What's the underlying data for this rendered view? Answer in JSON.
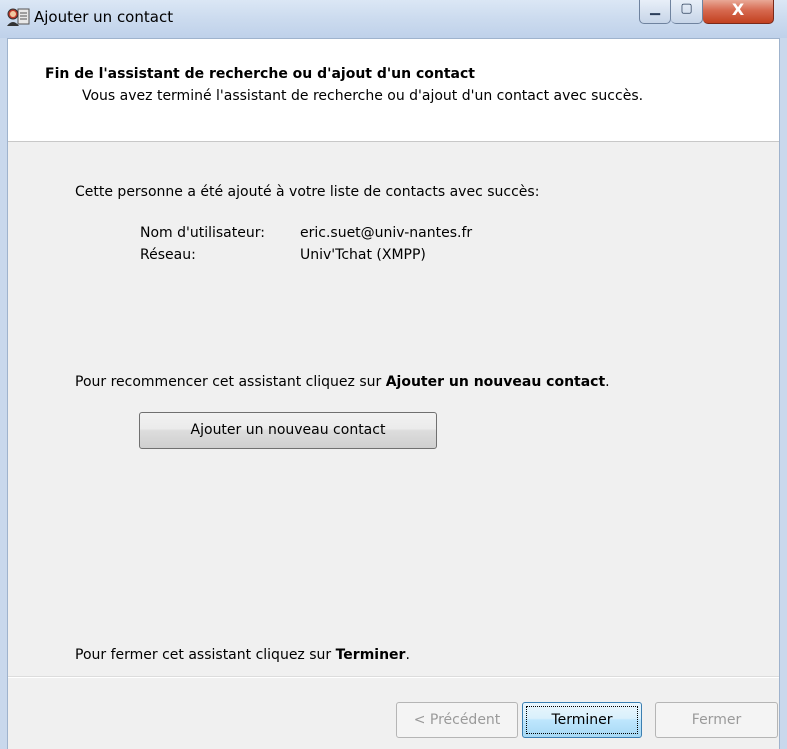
{
  "window": {
    "title": "Ajouter un contact",
    "controls": {
      "minimize": "▁",
      "maximize": "▢",
      "close": "X"
    }
  },
  "header": {
    "title": "Fin de l'assistant de recherche ou d'ajout d'un contact",
    "subtitle": "Vous avez terminé l'assistant de recherche ou d'ajout d'un contact avec succès."
  },
  "body": {
    "success_message": "Cette personne a été ajouté à votre liste de contacts avec succès:",
    "fields": [
      {
        "label": "Nom d'utilisateur:",
        "value": "eric.suet@univ-nantes.fr"
      },
      {
        "label": "Réseau:",
        "value": "Univ'Tchat (XMPP)"
      }
    ],
    "restart_prefix": "Pour recommencer cet assistant cliquez sur ",
    "restart_bold": "Ajouter un nouveau contact",
    "restart_suffix": ".",
    "add_button": "Ajouter un nouveau contact",
    "close_prefix": "Pour fermer cet assistant cliquez sur ",
    "close_bold": "Terminer",
    "close_suffix": "."
  },
  "footer": {
    "prev_button": "< Précédent",
    "finish_button": "Terminer",
    "close_button": "Fermer"
  },
  "icons": {
    "app": "contacts-icon"
  }
}
